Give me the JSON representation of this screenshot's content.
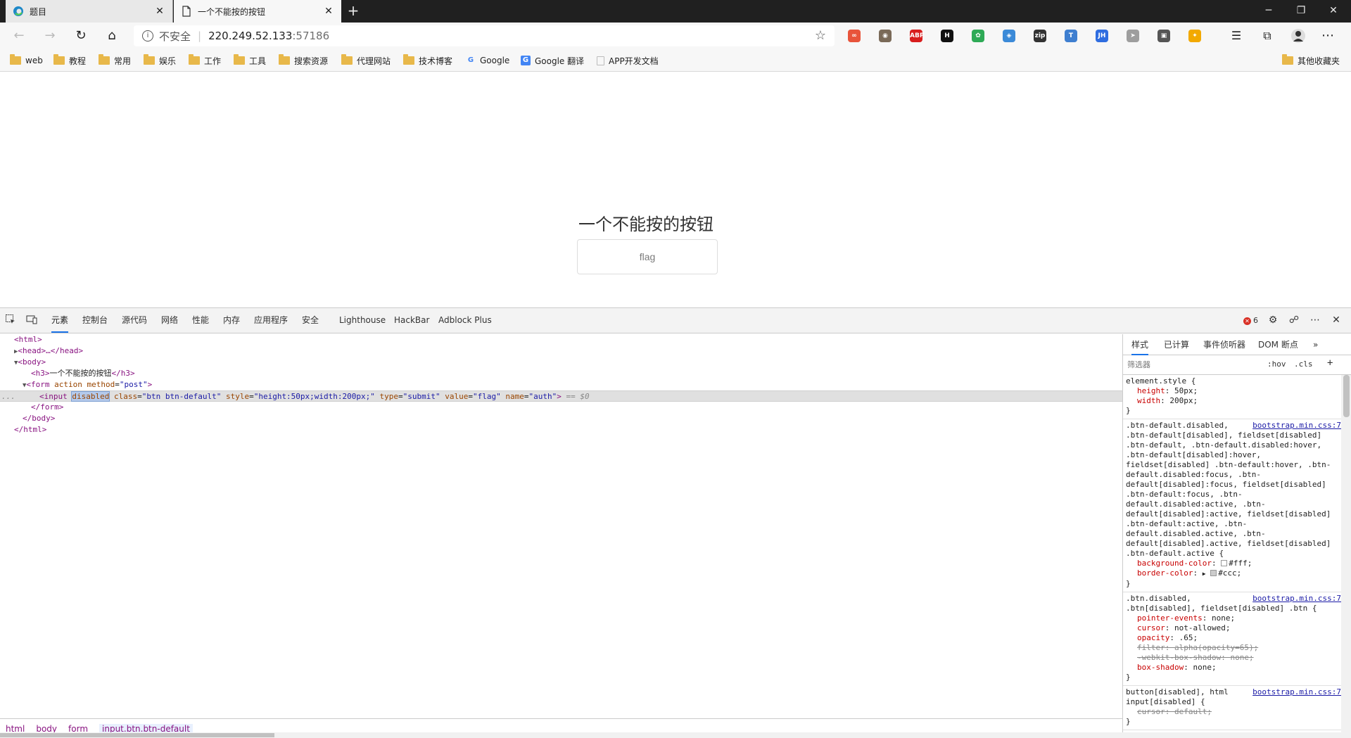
{
  "tabs": [
    {
      "title": "题目",
      "close": "✕"
    },
    {
      "title": "一个不能按的按钮",
      "close": "✕"
    }
  ],
  "new_tab": "+",
  "window": {
    "minimize": "─",
    "restore": "❐",
    "close": "✕"
  },
  "address": {
    "security_label": "不安全",
    "host": "220.249.52.133",
    "port": ":57186"
  },
  "extensions": [
    {
      "name": "infinity-icon",
      "label": "∞",
      "color": "#e8543b"
    },
    {
      "name": "owl-icon",
      "label": "◉",
      "color": "#7a6a58"
    },
    {
      "name": "adblock-plus-icon",
      "label": "ABP",
      "color": "#d81d1d"
    },
    {
      "name": "h-extension-icon",
      "label": "H",
      "color": "#111111"
    },
    {
      "name": "paw-icon",
      "label": "✿",
      "color": "#2eaa56"
    },
    {
      "name": "shield-extension-icon",
      "label": "◈",
      "color": "#3b8ad8"
    },
    {
      "name": "gitzip-icon",
      "label": "zip",
      "color": "#333333"
    },
    {
      "name": "translate-extension-icon",
      "label": "T",
      "color": "#3f7fd0"
    },
    {
      "name": "jh-icon",
      "label": "JH",
      "color": "#2f6de0"
    },
    {
      "name": "pointer-icon",
      "label": "➤",
      "color": "#9e9e9e"
    },
    {
      "name": "badge-extension-icon",
      "label": "▣",
      "color": "#555555"
    },
    {
      "name": "pinwheel-icon",
      "label": "✦",
      "color": "#f2a900"
    }
  ],
  "bookmarks": [
    {
      "label": "web",
      "type": "folder"
    },
    {
      "label": "教程",
      "type": "folder"
    },
    {
      "label": "常用",
      "type": "folder"
    },
    {
      "label": "娱乐",
      "type": "folder"
    },
    {
      "label": "工作",
      "type": "folder"
    },
    {
      "label": "工具",
      "type": "folder"
    },
    {
      "label": "搜索资源",
      "type": "folder"
    },
    {
      "label": "代理网站",
      "type": "folder"
    },
    {
      "label": "技术博客",
      "type": "folder"
    },
    {
      "label": "Google",
      "type": "google"
    },
    {
      "label": "Google 翻译",
      "type": "translate"
    },
    {
      "label": "APP开发文档",
      "type": "page"
    }
  ],
  "other_bookmarks": "其他收藏夹",
  "page": {
    "heading": "一个不能按的按钮",
    "button_value": "flag"
  },
  "devtools": {
    "tabs": [
      "元素",
      "控制台",
      "源代码",
      "网络",
      "性能",
      "内存",
      "应用程序",
      "安全",
      "Lighthouse",
      "HackBar",
      "Adblock Plus"
    ],
    "error_count": "6",
    "more_tabs": "»",
    "dom": {
      "html_open": "<html>",
      "head": "<head>…</head>",
      "body_open": "<body>",
      "h3_open": "<h3>",
      "h3_text": "一个不能按的按钮",
      "h3_close": "</h3>",
      "form_open_tag": "<form",
      "form_attr1": "action",
      "form_attr2": "method",
      "form_val2": "\"post\"",
      "form_gt": ">",
      "input_open": "<input",
      "input_disabled": "disabled",
      "attr_class": "class",
      "val_class": "\"btn btn-default\"",
      "attr_style": "style",
      "val_style": "\"height:50px;width:200px;\"",
      "attr_type": "type",
      "val_type": "\"submit\"",
      "attr_value": "value",
      "val_value": "\"flag\"",
      "attr_name": "name",
      "val_name": "\"auth\"",
      "input_gt": ">",
      "dollar": "== $0",
      "form_close": "</form>",
      "body_close": "</body>",
      "html_close": "</html>",
      "ellipsis": "..."
    },
    "breadcrumb": [
      "html",
      "body",
      "form",
      "input.btn.btn-default"
    ],
    "styles": {
      "tabs": [
        "样式",
        "已计算",
        "事件侦听器",
        "DOM 断点"
      ],
      "filter_placeholder": "筛选器",
      "hov": ":hov",
      "cls": ".cls",
      "add": "+",
      "rule1_selector": "element.style {",
      "rule1_d1_name": "height",
      "rule1_d1_value": "50px;",
      "rule1_d2_name": "width",
      "rule1_d2_value": "200px;",
      "close_brace": "}",
      "rule2_source": "bootstrap.min.css:7",
      "rule2_selector": ".btn-default.disabled,\n.btn-default[disabled], fieldset[disabled]\n.btn-default, .btn-default.disabled:hover,\n.btn-default[disabled]:hover,\nfieldset[disabled] .btn-default:hover, .btn-\ndefault.disabled:focus, .btn-\ndefault[disabled]:focus, fieldset[disabled]\n.btn-default:focus, .btn-\ndefault.disabled:active, .btn-\ndefault[disabled]:active, fieldset[disabled]\n.btn-default:active, .btn-\ndefault.disabled.active, .btn-\ndefault[disabled].active, fieldset[disabled]\n.btn-default.active {",
      "rule2_d1_name": "background-color",
      "rule2_d1_value": "#fff;",
      "rule2_d2_name": "border-color",
      "rule2_d2_value": "#ccc;",
      "rule3_source": "bootstrap.min.css:7",
      "rule3_selector": ".btn.disabled,\n.btn[disabled], fieldset[disabled] .btn {",
      "rule3_d1_name": "pointer-events",
      "rule3_d1_value": "none;",
      "rule3_d2_name": "cursor",
      "rule3_d2_value": "not-allowed;",
      "rule3_d3_name": "opacity",
      "rule3_d3_value": ".65;",
      "rule3_d4": "filter: alpha(opacity=65);",
      "rule3_d5": "-webkit-box-shadow: none;",
      "rule3_d6_name": "box-shadow",
      "rule3_d6_value": "none;",
      "rule4_source": "bootstrap.min.css:7",
      "rule4_selector": "button[disabled], html\ninput[disabled] {",
      "rule4_d1": "cursor: default;"
    }
  },
  "colors": {
    "tabstrip": "#202020",
    "toolbar": "#f7f7f7",
    "accent": "#1a73e8",
    "tag": "#881280",
    "attr_name": "#994500",
    "attr_value": "#1a1aa6",
    "css_prop": "#c80000"
  }
}
